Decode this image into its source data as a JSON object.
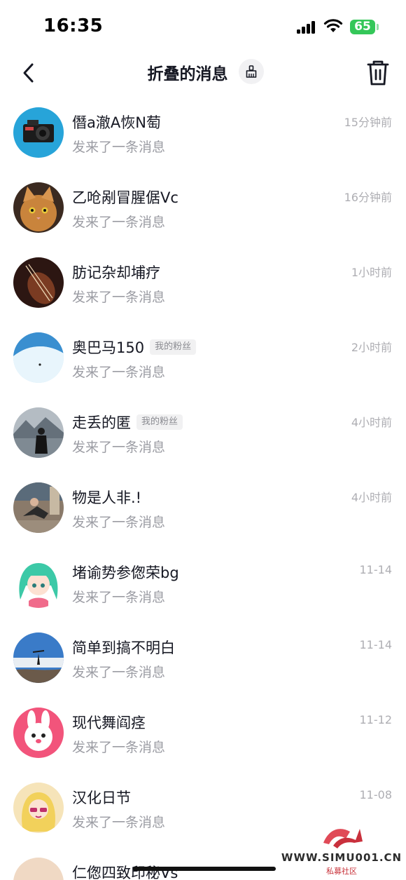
{
  "status_bar": {
    "time": "16:35",
    "battery": "65"
  },
  "nav": {
    "title": "折叠的消息"
  },
  "messages": [
    {
      "name": "僭a澈A恢N萄",
      "tag": "",
      "preview": "发来了一条消息",
      "time": "15分钟前",
      "avatar": "camera"
    },
    {
      "name": "乙呛剐冒腥倨Vc",
      "tag": "",
      "preview": "发来了一条消息",
      "time": "16分钟前",
      "avatar": "cat"
    },
    {
      "name": "肪记杂却埔疗",
      "tag": "",
      "preview": "发来了一条消息",
      "time": "1小时前",
      "avatar": "violin"
    },
    {
      "name": "奥巴马150",
      "tag": "我的粉丝",
      "preview": "发来了一条消息",
      "time": "2小时前",
      "avatar": "ice-cave"
    },
    {
      "name": "走丢的匿",
      "tag": "我的粉丝",
      "preview": "发来了一条消息",
      "time": "4小时前",
      "avatar": "lake-girl"
    },
    {
      "name": "物是人非.!",
      "tag": "",
      "preview": "发来了一条消息",
      "time": "4小时前",
      "avatar": "person-street"
    },
    {
      "name": "堵谕势参偬荣bg",
      "tag": "",
      "preview": "发来了一条消息",
      "time": "11-14",
      "avatar": "anime-girl"
    },
    {
      "name": "简单到搞不明白",
      "tag": "",
      "preview": "发来了一条消息",
      "time": "11-14",
      "avatar": "mountain-top"
    },
    {
      "name": "现代舞阎痉",
      "tag": "",
      "preview": "发来了一条消息",
      "time": "11-12",
      "avatar": "pink-bunny"
    },
    {
      "name": "汉化日节",
      "tag": "",
      "preview": "发来了一条消息",
      "time": "11-08",
      "avatar": "cartoon-girl"
    },
    {
      "name": "仁偬四致印秘Vs",
      "tag": "",
      "preview": "",
      "time": "",
      "avatar": "dog"
    }
  ],
  "watermark": {
    "text": "WWW.SIMU001.CN",
    "subtext": "私募社区"
  },
  "colors": {
    "text_primary": "#161823",
    "text_secondary": "#9b9ca3",
    "time": "#aeaeb3",
    "battery": "#34c759"
  }
}
